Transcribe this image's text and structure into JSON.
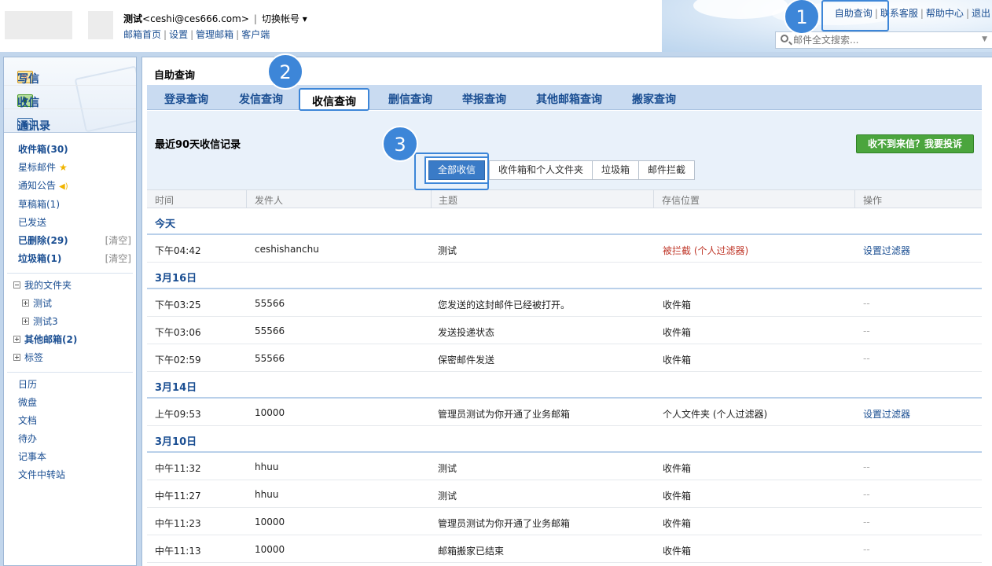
{
  "header": {
    "user_name": "测试",
    "user_email": "<ceshi@ces666.com>",
    "switch_account": "切换帐号 ▾",
    "links": [
      "邮箱首页",
      "设置",
      "管理邮箱",
      "客户端"
    ],
    "top_links": [
      "自助查询",
      "联系客服",
      "帮助中心",
      "退出"
    ],
    "search_placeholder": "邮件全文搜索..."
  },
  "sidebar": {
    "compose": [
      "写信",
      "收信",
      "通讯录"
    ],
    "folders": [
      {
        "label": "收件箱(30)",
        "bold": true
      },
      {
        "label": "星标邮件",
        "icon": "star-icon"
      },
      {
        "label": "通知公告",
        "icon": "speaker-icon"
      },
      {
        "label": "草稿箱(1)"
      },
      {
        "label": "已发送"
      },
      {
        "label": "已删除(29)",
        "bold": true,
        "clear": "[清空]"
      },
      {
        "label": "垃圾箱(1)",
        "bold": true,
        "clear": "[清空]"
      }
    ],
    "tree": {
      "my_folders": "我的文件夹",
      "sub": [
        "测试",
        "测试3"
      ],
      "other": "其他邮箱(2)",
      "tags": "标签"
    },
    "tools": [
      "日历",
      "微盘",
      "文档",
      "待办",
      "记事本",
      "文件中转站"
    ]
  },
  "main": {
    "title": "自助查询",
    "tabs": [
      "登录查询",
      "发信查询",
      "收信查询",
      "删信查询",
      "举报查询",
      "其他邮箱查询",
      "搬家查询"
    ],
    "active_tab": "收信查询",
    "panel_title": "最近90天收信记录",
    "complain_button": "收不到来信？我要投诉",
    "filters": [
      "全部收信",
      "收件箱和个人文件夹",
      "垃圾箱",
      "邮件拦截"
    ],
    "columns": [
      "时间",
      "发件人",
      "主题",
      "存信位置",
      "操作"
    ],
    "groups": [
      {
        "date": "今天",
        "rows": [
          {
            "time": "下午04:42",
            "sender": "ceshishanchu",
            "subject": "测试",
            "location": "被拦截 (个人过滤器)",
            "action": "设置过滤器",
            "location_blocked": true
          }
        ]
      },
      {
        "date": "3月16日",
        "rows": [
          {
            "time": "下午03:25",
            "sender": "55566",
            "subject": "您发送的这封邮件已经被打开。",
            "location": "收件箱",
            "action": "--"
          },
          {
            "time": "下午03:06",
            "sender": "55566",
            "subject": "发送投递状态",
            "location": "收件箱",
            "action": "--"
          },
          {
            "time": "下午02:59",
            "sender": "55566",
            "subject": "保密邮件发送",
            "location": "收件箱",
            "action": "--"
          }
        ]
      },
      {
        "date": "3月14日",
        "rows": [
          {
            "time": "上午09:53",
            "sender": "10000",
            "subject": "管理员测试为你开通了业务邮箱",
            "location": "个人文件夹 (个人过滤器)",
            "action": "设置过滤器"
          }
        ]
      },
      {
        "date": "3月10日",
        "rows": [
          {
            "time": "中午11:32",
            "sender": "hhuu",
            "subject": "测试",
            "location": "收件箱",
            "action": "--"
          },
          {
            "time": "中午11:27",
            "sender": "hhuu",
            "subject": "测试",
            "location": "收件箱",
            "action": "--"
          },
          {
            "time": "中午11:23",
            "sender": "10000",
            "subject": "管理员测试为你开通了业务邮箱",
            "location": "收件箱",
            "action": "--"
          },
          {
            "time": "中午11:13",
            "sender": "10000",
            "subject": "邮箱搬家已结束",
            "location": "收件箱",
            "action": "--"
          }
        ]
      }
    ]
  },
  "markers": [
    "1",
    "2",
    "3"
  ],
  "colors": {
    "accent": "#3d86d8",
    "link": "#1a4e92",
    "complain": "#4ba53d",
    "blocked": "#c0392b"
  }
}
